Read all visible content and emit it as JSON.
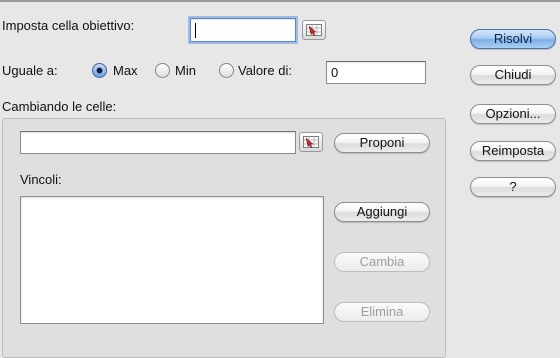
{
  "target_cell": {
    "label": "Imposta cella obiettivo:",
    "value": ""
  },
  "equal_to": {
    "label": "Uguale a:",
    "options": [
      {
        "label": "Max",
        "selected": true
      },
      {
        "label": "Min",
        "selected": false
      },
      {
        "label": "Valore di:",
        "selected": false
      }
    ],
    "value": "0"
  },
  "changing_cells": {
    "label": "Cambiando le celle:",
    "value": "",
    "guess_label": "Proponi"
  },
  "constraints": {
    "label": "Vincoli:",
    "items": [],
    "add_label": "Aggiungi",
    "change_label": "Cambia",
    "delete_label": "Elimina"
  },
  "actions": {
    "solve_label": "Risolvi",
    "close_label": "Chiudi",
    "options_label": "Opzioni...",
    "reset_label": "Reimposta",
    "help_label": "?"
  }
}
